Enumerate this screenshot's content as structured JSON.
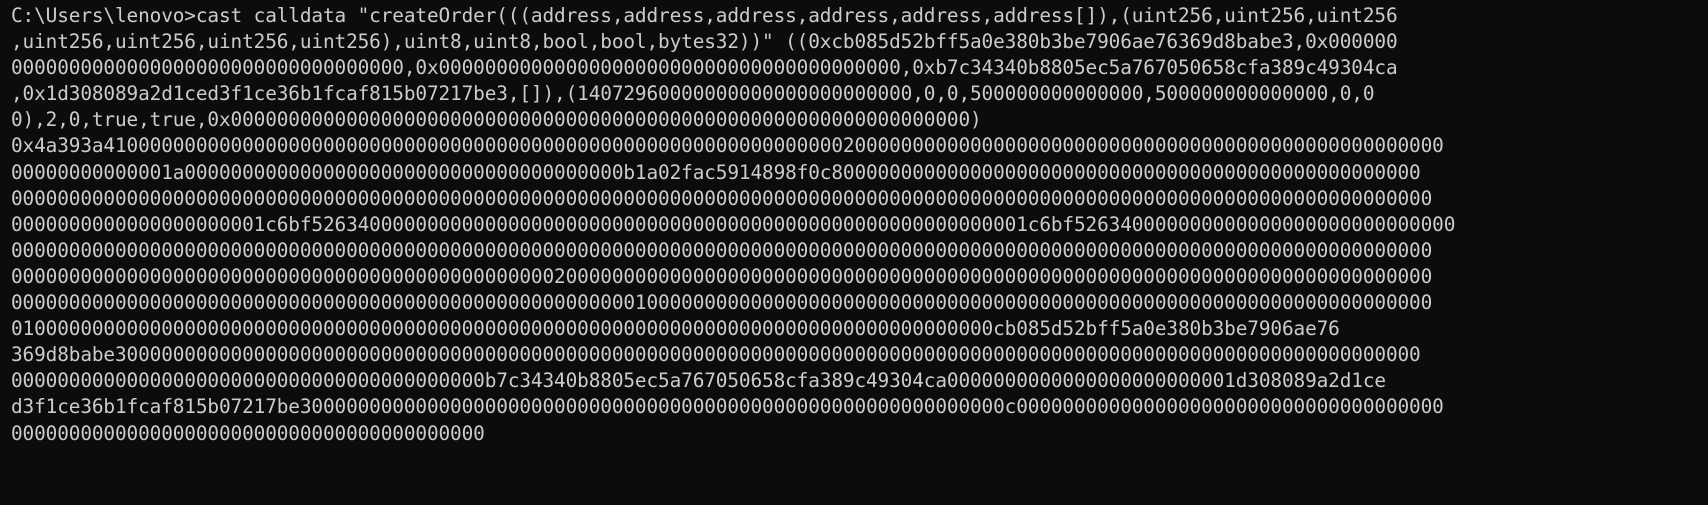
{
  "terminal": {
    "background": "#0c0c0c",
    "foreground": "#cccccc",
    "lines": [
      "C:\\Users\\lenovo>cast calldata \"createOrder(((address,address,address,address,address,address[]),(uint256,uint256,uint256",
      ",uint256,uint256,uint256,uint256),uint8,uint8,bool,bool,bytes32))\" ((0xcb085d52bff5a0e380b3be7906ae76369d8babe3,0x000000",
      "0000000000000000000000000000000000,0x0000000000000000000000000000000000000000,0xb7c34340b8805ec5a767050658cfa389c49304ca",
      ",0x1d308089a2d1ced3f1ce36b1fcaf815b07217be3,[]),(14072960000000000000000000000,0,0,500000000000000,500000000000000,0,0",
      "0),2,0,true,true,0x0000000000000000000000000000000000000000000000000000000000000000)",
      "0x4a393a41000000000000000000000000000000000000000000000000000000000000002000000000000000000000000000000000000000000000000000",
      "00000000000001a00000000000000000000000000000000000000b1a02fac5914898f0c800000000000000000000000000000000000000000000000000",
      "000000000000000000000000000000000000000000000000000000000000000000000000000000000000000000000000000000000000000000000000000",
      "0000000000000000000001c6bf52634000000000000000000000000000000000000000000000000000000001c6bf526340000000000000000000000000000",
      "000000000000000000000000000000000000000000000000000000000000000000000000000000000000000000000000000000000000000000000000000",
      "000000000000000000000000000000000000000000000002000000000000000000000000000000000000000000000000000000000000000000000000000",
      "000000000000000000000000000000000000000000000000000000100000000000000000000000000000000000000000000000000000000000000000000",
      "0100000000000000000000000000000000000000000000000000000000000000000000000000000000000cb085d52bff5a0e380b3be7906ae76",
      "369d8babe30000000000000000000000000000000000000000000000000000000000000000000000000000000000000000000000000000000000000000",
      "00000000000000000000000000000000000000000b7c34340b8805ec5a767050658cfa389c49304ca0000000000000000000000001d308089a2d1ce",
      "d3f1ce36b1fcaf815b07217be3000000000000000000000000000000000000000000000000000000000000c0000000000000000000000000000000000000",
      "00000000000000000000000000000000000000000"
    ]
  }
}
